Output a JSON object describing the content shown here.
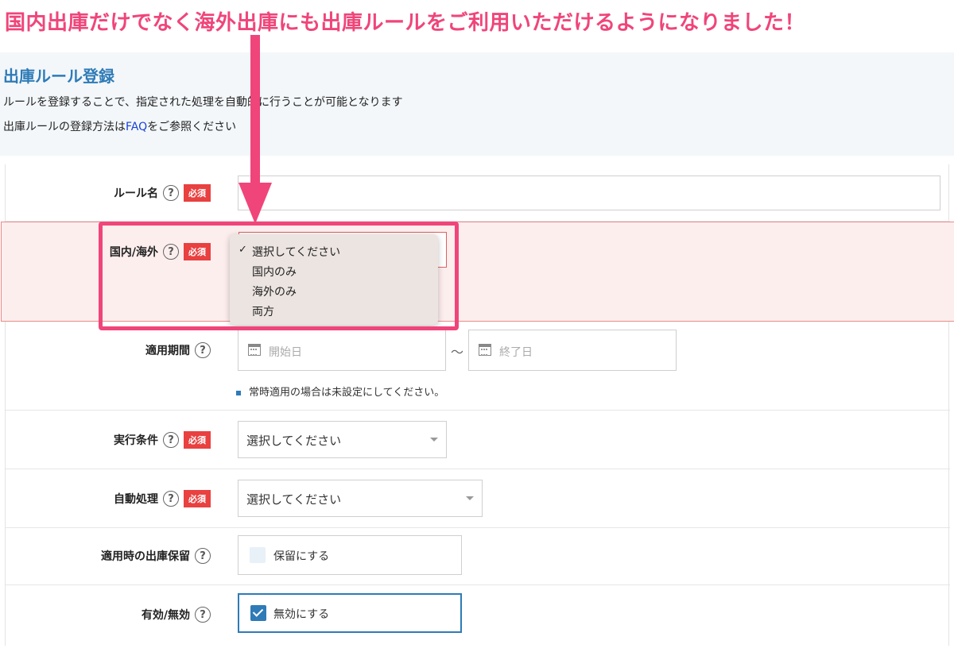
{
  "banner": {
    "text": "国内出庫だけでなく海外出庫にも出庫ルールをご利用いただけるようになりました！",
    "color": "#f0457a"
  },
  "page": {
    "title": "出庫ルール登録",
    "description": "ルールを登録することで、指定された処理を自動的に行うことが可能となります",
    "faq_prefix": "出庫ルールの登録方法は",
    "faq_link": "FAQ",
    "faq_suffix": "をご参照ください"
  },
  "form": {
    "help_symbol": "?",
    "required_label": "必須",
    "rule_name": {
      "label": "ルール名",
      "value": ""
    },
    "domestic_overseas": {
      "label": "国内/海外",
      "dropdown_options": [
        "選択してください",
        "国内のみ",
        "海外のみ",
        "両方"
      ],
      "selected_index": 0,
      "check_mark": "✓"
    },
    "period": {
      "label": "適用期間",
      "start_placeholder": "開始日",
      "end_placeholder": "終了日",
      "separator": "〜",
      "note": "常時適用の場合は未設定にしてください。"
    },
    "condition": {
      "label": "実行条件",
      "value": "選択してください"
    },
    "auto_process": {
      "label": "自動処理",
      "value": "選択してください"
    },
    "hold": {
      "label": "適用時の出庫保留",
      "checkbox_label": "保留にする",
      "checked": false
    },
    "enabled": {
      "label": "有効/無効",
      "checkbox_label": "無効にする",
      "checked": true
    }
  },
  "colors": {
    "accent": "#2e7bb7",
    "required": "#e94040",
    "highlight": "#f0457a",
    "error_bg": "#fdeeee"
  }
}
